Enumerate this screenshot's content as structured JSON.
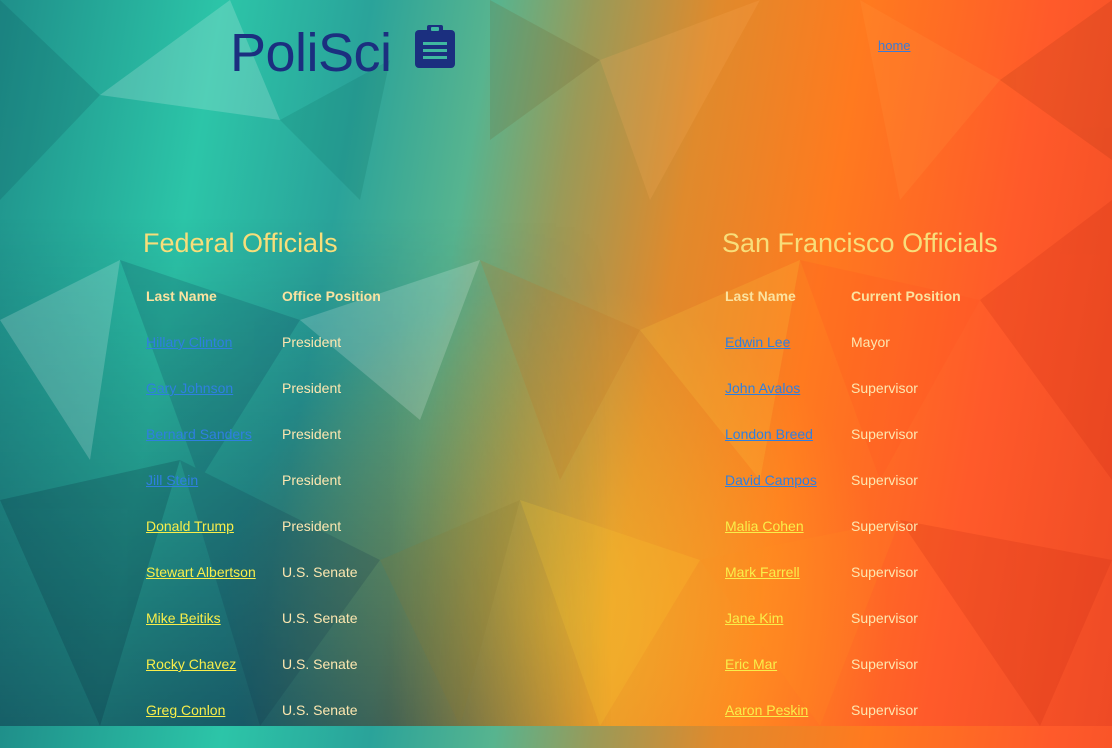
{
  "header": {
    "logo_text": "PoliSci",
    "logo_icon": "clipboard-icon",
    "home_link": "home"
  },
  "federal": {
    "title": "Federal Officials",
    "col_name": "Last Name",
    "col_position": "Office Position",
    "rows": [
      {
        "name": "Hillary Clinton",
        "position": "President",
        "link_color": "#2f7fe0"
      },
      {
        "name": "Gary Johnson",
        "position": "President",
        "link_color": "#2f7fe0"
      },
      {
        "name": "Bernard Sanders",
        "position": "President",
        "link_color": "#2f7fe0"
      },
      {
        "name": "Jill Stein",
        "position": "President",
        "link_color": "#2f7fe0"
      },
      {
        "name": "Donald Trump",
        "position": "President",
        "link_color": "#f9ee4a"
      },
      {
        "name": "Stewart Albertson",
        "position": "U.S. Senate",
        "link_color": "#f9ee4a"
      },
      {
        "name": "Mike Beitiks",
        "position": "U.S. Senate",
        "link_color": "#f9ee4a"
      },
      {
        "name": "Rocky Chavez",
        "position": "U.S. Senate",
        "link_color": "#f9ee4a"
      },
      {
        "name": "Greg Conlon",
        "position": "U.S. Senate",
        "link_color": "#f9ee4a"
      }
    ]
  },
  "sf": {
    "title": "San Francisco Officials",
    "col_name": "Last Name",
    "col_position": "Current Position",
    "rows": [
      {
        "name": "Edwin Lee",
        "position": "Mayor",
        "link_color": "#2f7fe0"
      },
      {
        "name": "John Avalos",
        "position": "Supervisor",
        "link_color": "#2f7fe0"
      },
      {
        "name": "London Breed",
        "position": "Supervisor",
        "link_color": "#2f7fe0"
      },
      {
        "name": "David Campos",
        "position": "Supervisor",
        "link_color": "#2f7fe0"
      },
      {
        "name": "Malia Cohen",
        "position": "Supervisor",
        "link_color": "#f9ee4a"
      },
      {
        "name": "Mark Farrell",
        "position": "Supervisor",
        "link_color": "#f9ee4a"
      },
      {
        "name": "Jane Kim",
        "position": "Supervisor",
        "link_color": "#f9ee4a"
      },
      {
        "name": "Eric Mar",
        "position": "Supervisor",
        "link_color": "#f9ee4a"
      },
      {
        "name": "Aaron Peskin",
        "position": "Supervisor",
        "link_color": "#f9ee4a"
      }
    ]
  },
  "colors": {
    "logo": "#1b2f7f",
    "heading": "#f8de7a",
    "visited_link": "#2f7fe0",
    "link": "#f9ee4a"
  }
}
